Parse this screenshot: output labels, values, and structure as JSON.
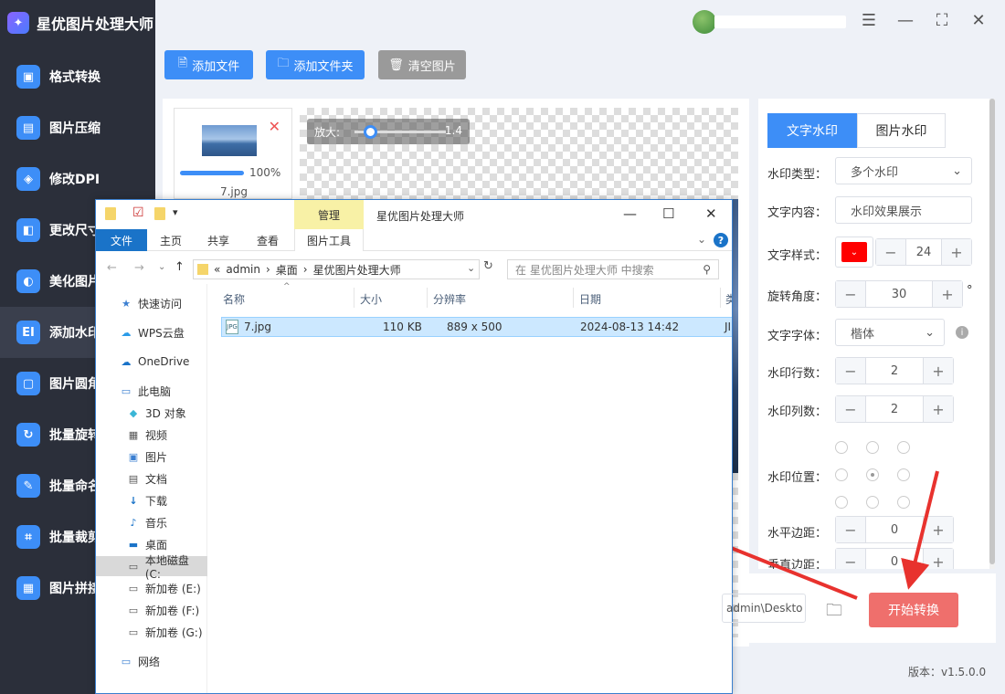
{
  "app": {
    "title": "星优图片处理大师",
    "version": "版本：v1.5.0.0",
    "logo_icon": "✦"
  },
  "sidebar": {
    "items": [
      {
        "label": "格式转换",
        "icon": "▣"
      },
      {
        "label": "图片压缩",
        "icon": "▤"
      },
      {
        "label": "修改DPI",
        "icon": "◈"
      },
      {
        "label": "更改尺寸",
        "icon": "◧"
      },
      {
        "label": "美化图片",
        "icon": "◐"
      },
      {
        "label": "添加水印",
        "icon": "EI"
      },
      {
        "label": "图片圆角",
        "icon": "▢"
      },
      {
        "label": "批量旋转",
        "icon": "↻"
      },
      {
        "label": "批量命名",
        "icon": "✎"
      },
      {
        "label": "批量裁剪",
        "icon": "⌗"
      },
      {
        "label": "图片拼接",
        "icon": "▦"
      }
    ]
  },
  "window": {
    "settings_icon": "☰",
    "minimize": "—",
    "maximize": "⛶",
    "close": "✕"
  },
  "toolbar": {
    "add_file": "添加文件",
    "add_folder": "添加文件夹",
    "clear": "清空图片",
    "add_file_icon": "🗎",
    "add_folder_icon": "🗀",
    "clear_icon": "🗑"
  },
  "thumbnail": {
    "percent": "100%",
    "name": "7.jpg",
    "close": "✕",
    "progress": 1.0
  },
  "preview": {
    "zoom_label": "放大:",
    "zoom_value": "1.4"
  },
  "panel": {
    "tabs": {
      "text": "文字水印",
      "image": "图片水印"
    },
    "labels": {
      "type": "水印类型：",
      "content": "文字内容：",
      "style": "文字样式：",
      "angle": "旋转角度：",
      "font": "文字字体：",
      "rows": "水印行数：",
      "cols": "水印列数：",
      "position": "水印位置：",
      "hmargin": "水平边距：",
      "vmargin": "垂直边距："
    },
    "type_value": "多个水印",
    "content_value": "水印效果展示",
    "text_color": "#ff0000",
    "font_size": "24",
    "angle": "30",
    "degree": "°",
    "font_value": "楷体",
    "rows": "2",
    "cols": "2",
    "hmargin": "0",
    "vmargin": "0",
    "minus": "−",
    "plus": "+",
    "info_icon": "i"
  },
  "bottom": {
    "output_path": "admin\\Deskto",
    "start": "开始转换"
  },
  "explorer": {
    "manage": "管理",
    "title": "星优图片处理大师",
    "ribbon": {
      "file": "文件",
      "home": "主页",
      "share": "共享",
      "view": "查看",
      "picture_tools": "图片工具"
    },
    "address": {
      "prefix": "«",
      "p1": "admin",
      "sep": "›",
      "p2": "桌面",
      "p3": "星优图片处理大师"
    },
    "search_placeholder": "在 星优图片处理大师 中搜索",
    "nav": [
      {
        "label": "快速访问",
        "icon": "★"
      },
      {
        "label": "WPS云盘",
        "icon": "☁"
      },
      {
        "label": "OneDrive",
        "icon": "☁"
      },
      {
        "label": "此电脑",
        "icon": "▭"
      },
      {
        "label": "3D 对象",
        "icon": "◆"
      },
      {
        "label": "视频",
        "icon": "▦"
      },
      {
        "label": "图片",
        "icon": "▣"
      },
      {
        "label": "文档",
        "icon": "▤"
      },
      {
        "label": "下载",
        "icon": "↓"
      },
      {
        "label": "音乐",
        "icon": "♪"
      },
      {
        "label": "桌面",
        "icon": "▬"
      },
      {
        "label": "本地磁盘 (C:",
        "icon": "▭"
      },
      {
        "label": "新加卷 (E:)",
        "icon": "▭"
      },
      {
        "label": "新加卷 (F:)",
        "icon": "▭"
      },
      {
        "label": "新加卷 (G:)",
        "icon": "▭"
      },
      {
        "label": "网络",
        "icon": "▭"
      }
    ],
    "columns": {
      "name": "名称",
      "size": "大小",
      "resolution": "分辨率",
      "date": "日期",
      "type": "类"
    },
    "file": {
      "name": "7.jpg",
      "size": "110 KB",
      "resolution": "889 x 500",
      "date": "2024-08-13 14:42",
      "type": "JI"
    }
  }
}
